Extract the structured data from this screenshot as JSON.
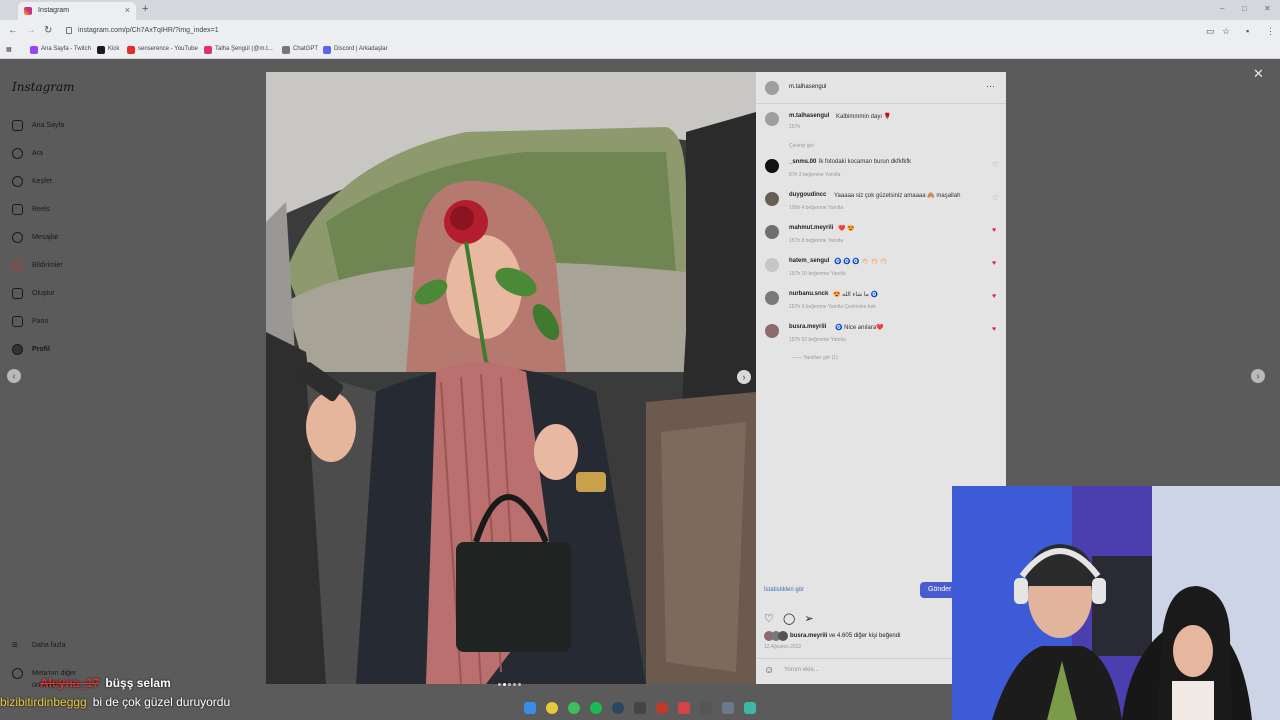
{
  "browser": {
    "tab_title": "Instagram",
    "url": "instagram.com/p/Ch7AxTqIHR/?img_index=1",
    "bookmarks": [
      "Ana Sayfa - Twitch",
      "Kick",
      "senserence - YouTube",
      "Talha Şengül (@m.t...",
      "ChatGPT",
      "Discord | Arkadaşlar"
    ]
  },
  "sidebar": {
    "logo": "Instagram",
    "items": [
      {
        "label": "Ana Sayfa",
        "icon": "home-icon"
      },
      {
        "label": "Ara",
        "icon": "search-icon"
      },
      {
        "label": "Keşfet",
        "icon": "compass-icon"
      },
      {
        "label": "Reels",
        "icon": "reels-icon"
      },
      {
        "label": "Mesajlar",
        "icon": "messenger-icon"
      },
      {
        "label": "Bildirimler",
        "icon": "heart-icon"
      },
      {
        "label": "Oluştur",
        "icon": "plus-icon"
      },
      {
        "label": "Pano",
        "icon": "dashboard-icon"
      },
      {
        "label": "Profil",
        "icon": "avatar-icon"
      }
    ],
    "more": "Daha fazla",
    "meta": "Meta'nın diğer ürünleri"
  },
  "post": {
    "author": "m.talhasengul",
    "caption_user": "m.talhasengul",
    "caption": "Kalbimmmin dayı 🌹",
    "caption_time": "157h",
    "see_translation": "Çeviriyi gör",
    "comments": [
      {
        "user": "_snms.00",
        "text": "lk fotodaki kocaman burun dkfkfkfk",
        "meta": "87h   3 beğenme   Yanıtla",
        "liked": false,
        "avatar": "#111111"
      },
      {
        "user": "duygoudincc",
        "text": "Yaaaaa siz çok güzelsiniz amaaaa 🙈 maşallah",
        "meta": "100h   4 beğenme   Yanıtla",
        "liked": false,
        "avatar": "#6a5d52"
      },
      {
        "user": "mahmut.meyrili",
        "text": "❤️ 😍",
        "meta": "157h   8 beğenme   Yanıtla",
        "liked": true,
        "avatar": "#6f6f6f"
      },
      {
        "user": "hatem_sengul",
        "text": "🧿 🧿 🧿 👏🏻 👏🏻 👏🏻",
        "meta": "157h   10 beğenme   Yanıtla",
        "liked": true,
        "avatar": "#c6c6c6"
      },
      {
        "user": "nurbanu.snck",
        "text": "😍 ما شاء الله 🧿",
        "meta": "157h   9 beğenme   Yanıtla   Çevirisine bak",
        "liked": true,
        "avatar": "#7a7a7a"
      },
      {
        "user": "busra.meyrili",
        "text": "🧿 Nice anılara❤️",
        "meta": "157h   52 beğenme   Yanıtla",
        "liked": true,
        "avatar": "#8d6a6d"
      }
    ],
    "view_replies": "Yanıtları gör (1)",
    "stats_link": "İstatistikleri gör",
    "send_label": "Gönder",
    "likes_user": "busra.meyrili",
    "likes_rest": "ve 4.605 diğer kişi beğendi",
    "date": "12 Ağustos 2022",
    "add_comment": "Yorum ekle..."
  },
  "chat": [
    {
      "user": "Aleyna_17",
      "message": "büşş selam"
    },
    {
      "user": "bizibitirdinbeggg",
      "message": "bi de çok güzel duruyordu"
    }
  ],
  "colors": {
    "accent": "#4a5bd0",
    "like_red": "#e0243c",
    "chat_user_1": "#e23b3b",
    "chat_user_2": "#e7c93a"
  }
}
